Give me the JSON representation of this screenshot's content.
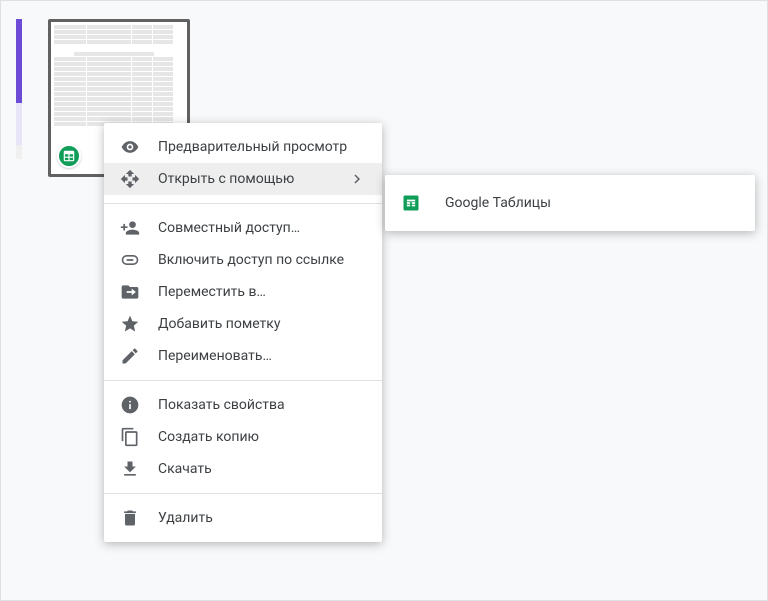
{
  "file": {
    "badge_icon": "sheets-icon"
  },
  "menu": {
    "items": [
      {
        "icon": "eye",
        "label": "Предварительный просмотр"
      },
      {
        "icon": "open-with",
        "label": "Открыть с помощью",
        "has_submenu": true,
        "active": true
      },
      {
        "divider": true
      },
      {
        "icon": "person-add",
        "label": "Совместный доступ…"
      },
      {
        "icon": "link",
        "label": "Включить доступ по ссылке"
      },
      {
        "icon": "move-to",
        "label": "Переместить в…"
      },
      {
        "icon": "star",
        "label": "Добавить пометку"
      },
      {
        "icon": "rename",
        "label": "Переименовать…"
      },
      {
        "divider": true
      },
      {
        "icon": "info",
        "label": "Показать свойства"
      },
      {
        "icon": "copy",
        "label": "Создать копию"
      },
      {
        "icon": "download",
        "label": "Скачать"
      },
      {
        "divider": true
      },
      {
        "icon": "trash",
        "label": "Удалить"
      }
    ]
  },
  "submenu": {
    "items": [
      {
        "icon": "sheets",
        "label": "Google Таблицы"
      }
    ]
  }
}
